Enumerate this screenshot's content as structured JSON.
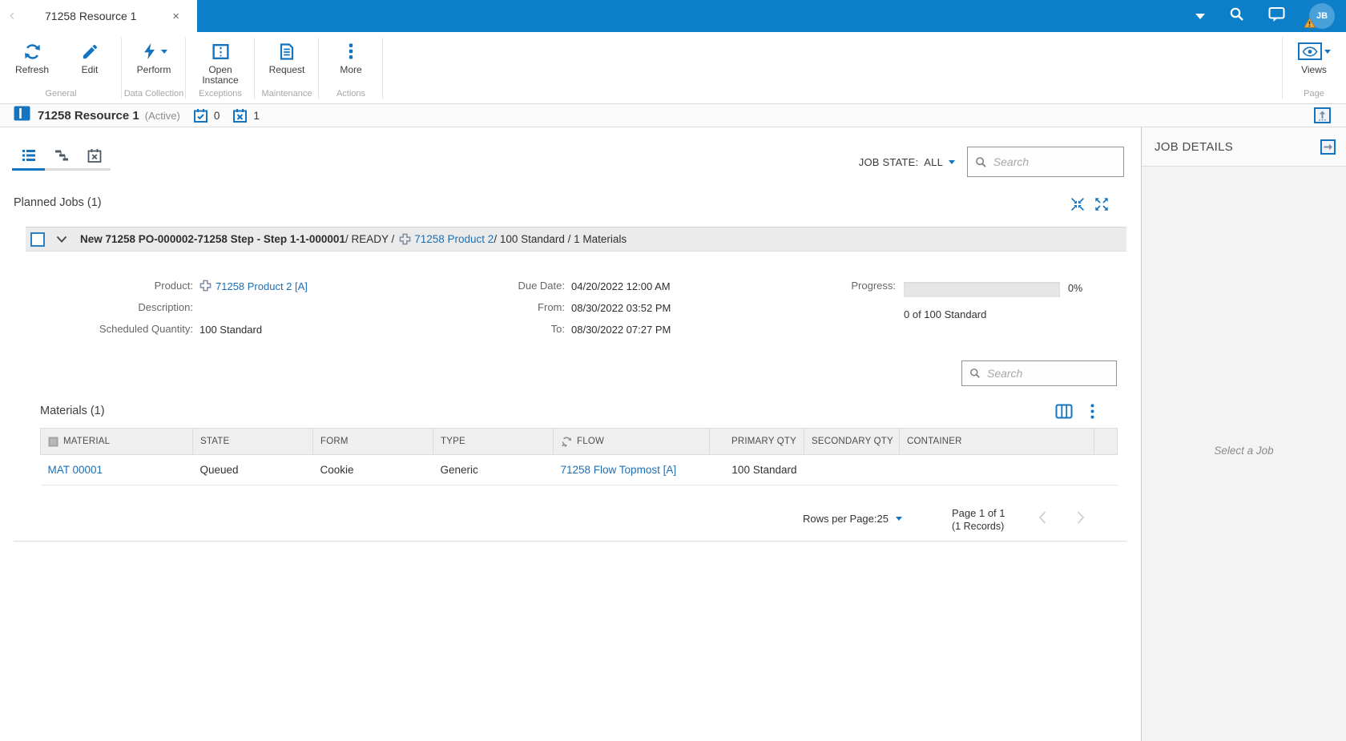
{
  "colors": {
    "topbar": "#0d7fc9",
    "accent": "#1574bf",
    "link": "#1d6fb5",
    "warning": "#f2a93b"
  },
  "topbar": {
    "tab_title": "71258 Resource 1",
    "close_glyph": "×",
    "avatar_initials": "JB"
  },
  "ribbon": {
    "refresh_label": "Refresh",
    "edit_label": "Edit",
    "perform_label": "Perform",
    "open_instance_label": "Open Instance",
    "request_label": "Request",
    "more_label": "More",
    "views_label": "Views",
    "groups": {
      "general": "General",
      "data_collection": "Data Collection",
      "exceptions": "Exceptions",
      "maintenance": "Maintenance",
      "actions": "Actions",
      "page": "Page"
    }
  },
  "entity": {
    "title": "71258 Resource 1",
    "state": "(Active)",
    "checked_count": "0",
    "crossed_count": "1"
  },
  "jobs_toolbar": {
    "job_state_label": "JOB STATE:",
    "job_state_value": "ALL",
    "search_placeholder": "Search"
  },
  "planned_jobs": {
    "title": "Planned Jobs (1)"
  },
  "job": {
    "title_bold": "New 71258 PO-000002-71258 Step - Step 1-1-000001",
    "title_mid": "/ READY /",
    "product_link": "71258 Product 2",
    "title_tail": " / 100 Standard / 1 Materials",
    "details": {
      "product_label": "Product:",
      "product_value": "71258 Product 2 [A]",
      "description_label": "Description:",
      "description_value": "",
      "scheduled_quantity_label": "Scheduled Quantity:",
      "scheduled_quantity_value": "100 Standard",
      "due_date_label": "Due Date:",
      "due_date_value": "04/20/2022 12:00 AM",
      "from_label": "From:",
      "from_value": "08/30/2022 03:52 PM",
      "to_label": "To:",
      "to_value": "08/30/2022 07:27 PM",
      "progress_label": "Progress:",
      "progress_percent": 0,
      "progress_percent_label": "0%",
      "progress_sub": "0 of 100 Standard"
    }
  },
  "materials": {
    "title": "Materials (1)",
    "search_placeholder": "Search",
    "columns": [
      "MATERIAL",
      "STATE",
      "FORM",
      "TYPE",
      "FLOW",
      "PRIMARY QTY",
      "SECONDARY QTY",
      "CONTAINER"
    ],
    "rows": [
      {
        "material": "MAT 00001",
        "state": "Queued",
        "form": "Cookie",
        "type": "Generic",
        "flow": "71258 Flow Topmost [A]",
        "primary_qty": "100 Standard",
        "secondary_qty": "",
        "container": ""
      }
    ],
    "pagination": {
      "rows_per_page_label": "Rows per Page:",
      "rows_per_page_value": "25",
      "page_info": "Page 1 of 1",
      "records_info": "(1 Records)"
    }
  },
  "job_details_panel": {
    "title": "JOB DETAILS",
    "empty_message": "Select a Job"
  }
}
